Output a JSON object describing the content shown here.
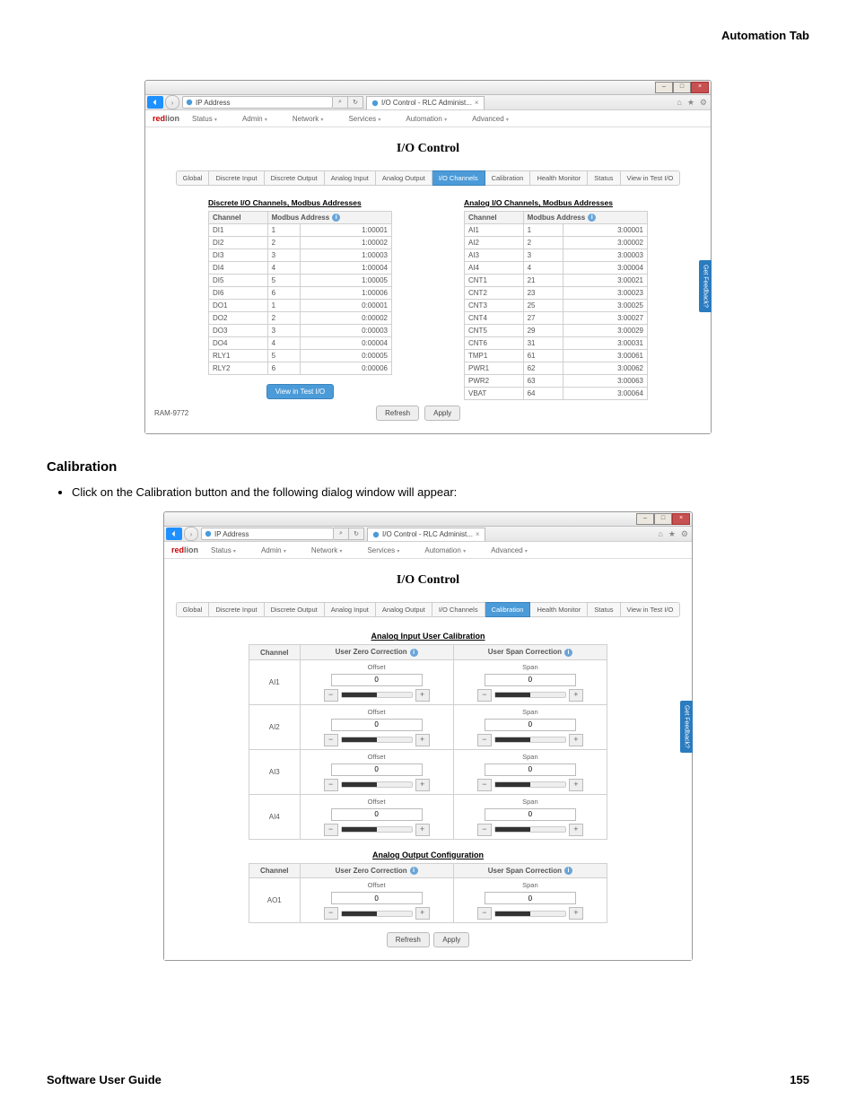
{
  "doc": {
    "header_right": "Automation Tab",
    "section_title": "Calibration",
    "bullet": "Click on the Calibration button and the following dialog window will appear:",
    "footer_left": "Software User Guide",
    "footer_right": "155"
  },
  "common": {
    "address_label": "IP Address",
    "tab_title": "I/O Control - RLC Administ...",
    "logo_red": "red",
    "logo_rest": "lion",
    "menu": [
      "Status",
      "Admin",
      "Network",
      "Services",
      "Automation",
      "Advanced"
    ],
    "io_heading": "I/O Control",
    "subtabs": [
      "Global",
      "Discrete Input",
      "Discrete Output",
      "Analog Input",
      "Analog Output",
      "I/O Channels",
      "Calibration",
      "Health Monitor",
      "Status",
      "View in Test I/O"
    ],
    "refresh": "Refresh",
    "apply": "Apply",
    "feedback": "Get Feedback?",
    "info_icon": "i"
  },
  "shot1": {
    "active_tab_index": 5,
    "discrete_title": "Discrete I/O Channels, Modbus Addresses",
    "analog_title": "Analog I/O Channels, Modbus Addresses",
    "col_channel": "Channel",
    "col_modbus": "Modbus Address",
    "viewtest_btn": "View in Test I/O",
    "device": "RAM-9772",
    "discrete_rows": [
      {
        "ch": "DI1",
        "addr": "1",
        "full": "1:00001"
      },
      {
        "ch": "DI2",
        "addr": "2",
        "full": "1:00002"
      },
      {
        "ch": "DI3",
        "addr": "3",
        "full": "1:00003"
      },
      {
        "ch": "DI4",
        "addr": "4",
        "full": "1:00004"
      },
      {
        "ch": "DI5",
        "addr": "5",
        "full": "1:00005"
      },
      {
        "ch": "DI6",
        "addr": "6",
        "full": "1:00006"
      },
      {
        "ch": "DO1",
        "addr": "1",
        "full": "0:00001"
      },
      {
        "ch": "DO2",
        "addr": "2",
        "full": "0:00002"
      },
      {
        "ch": "DO3",
        "addr": "3",
        "full": "0:00003"
      },
      {
        "ch": "DO4",
        "addr": "4",
        "full": "0:00004"
      },
      {
        "ch": "RLY1",
        "addr": "5",
        "full": "0:00005"
      },
      {
        "ch": "RLY2",
        "addr": "6",
        "full": "0:00006"
      }
    ],
    "analog_rows": [
      {
        "ch": "AI1",
        "addr": "1",
        "full": "3:00001"
      },
      {
        "ch": "AI2",
        "addr": "2",
        "full": "3:00002"
      },
      {
        "ch": "AI3",
        "addr": "3",
        "full": "3:00003"
      },
      {
        "ch": "AI4",
        "addr": "4",
        "full": "3:00004"
      },
      {
        "ch": "CNT1",
        "addr": "21",
        "full": "3:00021"
      },
      {
        "ch": "CNT2",
        "addr": "23",
        "full": "3:00023"
      },
      {
        "ch": "CNT3",
        "addr": "25",
        "full": "3:00025"
      },
      {
        "ch": "CNT4",
        "addr": "27",
        "full": "3:00027"
      },
      {
        "ch": "CNT5",
        "addr": "29",
        "full": "3:00029"
      },
      {
        "ch": "CNT6",
        "addr": "31",
        "full": "3:00031"
      },
      {
        "ch": "TMP1",
        "addr": "61",
        "full": "3:00061"
      },
      {
        "ch": "PWR1",
        "addr": "62",
        "full": "3:00062"
      },
      {
        "ch": "PWR2",
        "addr": "63",
        "full": "3:00063"
      },
      {
        "ch": "VBAT",
        "addr": "64",
        "full": "3:00064"
      }
    ]
  },
  "shot2": {
    "active_tab_index": 6,
    "ain_title": "Analog Input User Calibration",
    "aout_title": "Analog Output Configuration",
    "col_channel": "Channel",
    "col_zero": "User Zero Correction",
    "col_span": "User Span Correction",
    "offset_label": "Offset",
    "span_label": "Span",
    "ain_rows": [
      {
        "ch": "AI1",
        "offset": "0",
        "span": "0"
      },
      {
        "ch": "AI2",
        "offset": "0",
        "span": "0"
      },
      {
        "ch": "AI3",
        "offset": "0",
        "span": "0"
      },
      {
        "ch": "AI4",
        "offset": "0",
        "span": "0"
      }
    ],
    "aout_rows": [
      {
        "ch": "AO1",
        "offset": "0",
        "span": "0"
      }
    ]
  }
}
